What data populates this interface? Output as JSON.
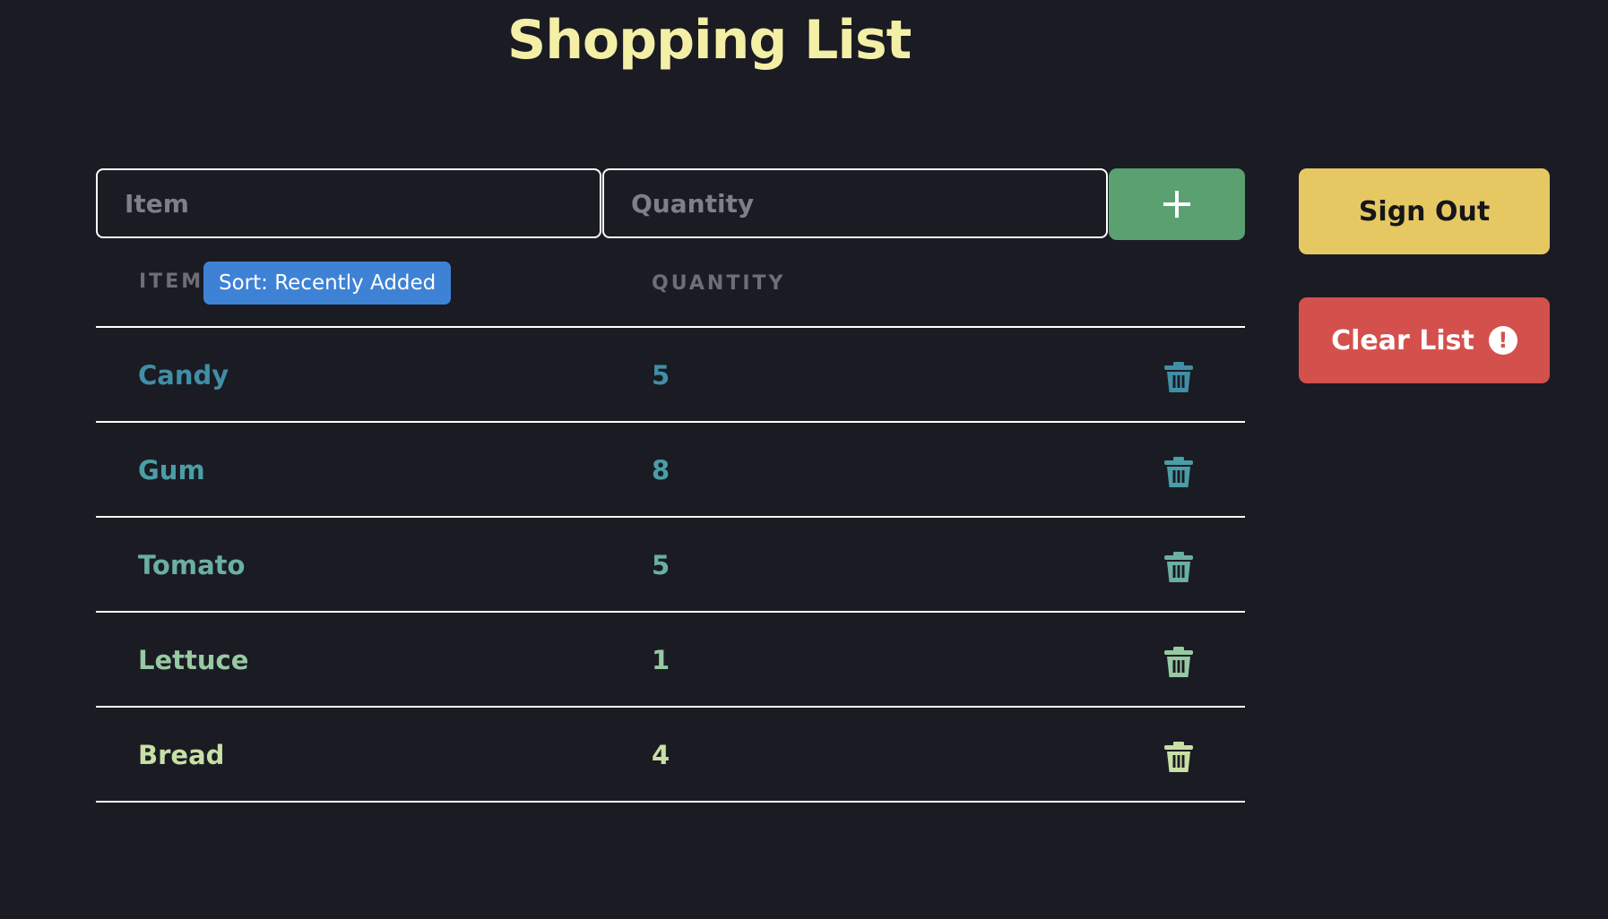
{
  "title": "Shopping List",
  "form": {
    "item_placeholder": "Item",
    "quantity_placeholder": "Quantity",
    "add_icon": "plus-icon"
  },
  "headers": {
    "item": "ITEM",
    "quantity": "QUANTITY",
    "sort": "Sort: Recently Added"
  },
  "buttons": {
    "sign_out": "Sign Out",
    "clear_list": "Clear List",
    "clear_icon": "alert-icon"
  },
  "items": [
    {
      "name": "Candy",
      "quantity": "5",
      "color": "#3f8fa6"
    },
    {
      "name": "Gum",
      "quantity": "8",
      "color": "#4a9ea6"
    },
    {
      "name": "Tomato",
      "quantity": "5",
      "color": "#6ab0a0"
    },
    {
      "name": "Lettuce",
      "quantity": "1",
      "color": "#97c9a3"
    },
    {
      "name": "Bread",
      "quantity": "4",
      "color": "#c7e0a5"
    }
  ],
  "colors": {
    "background": "#1b1b24",
    "title": "#f3efa6",
    "add_button": "#5aa071",
    "sign_out": "#e6c862",
    "clear_list": "#d4504c",
    "sort_badge": "#3e82d6"
  }
}
